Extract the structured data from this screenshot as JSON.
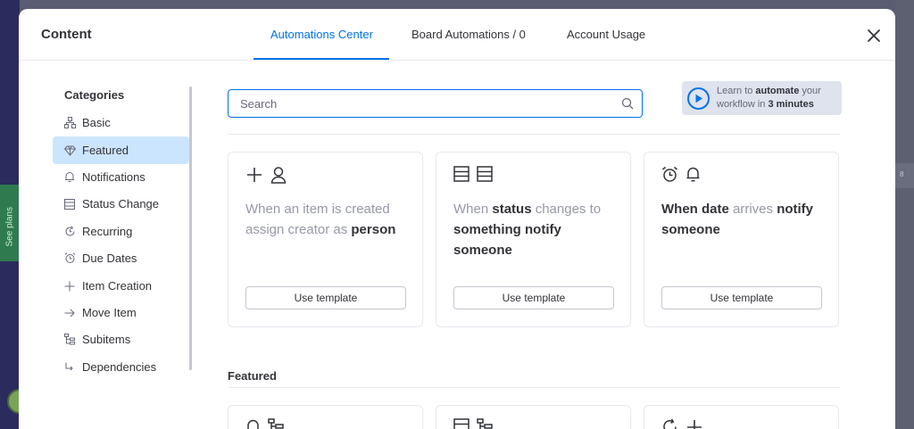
{
  "background": {
    "see_plans": "See plans",
    "right_count": "8"
  },
  "modal": {
    "title": "Content",
    "tabs": [
      {
        "label": "Automations Center",
        "active": true
      },
      {
        "label": "Board Automations / 0",
        "active": false
      },
      {
        "label": "Account Usage",
        "active": false
      }
    ],
    "close_icon": "close-icon"
  },
  "sidebar": {
    "heading": "Categories",
    "items": [
      {
        "label": "Basic",
        "icon": "sitemap-icon",
        "active": false
      },
      {
        "label": "Featured",
        "icon": "diamond-icon",
        "active": true
      },
      {
        "label": "Notifications",
        "icon": "bell-icon",
        "active": false
      },
      {
        "label": "Status Change",
        "icon": "table-icon",
        "active": false
      },
      {
        "label": "Recurring",
        "icon": "recurring-icon",
        "active": false
      },
      {
        "label": "Due Dates",
        "icon": "alarm-icon",
        "active": false
      },
      {
        "label": "Item Creation",
        "icon": "plus-icon",
        "active": false
      },
      {
        "label": "Move Item",
        "icon": "arrow-right-icon",
        "active": false
      },
      {
        "label": "Subitems",
        "icon": "subitems-icon",
        "active": false
      },
      {
        "label": "Dependencies",
        "icon": "dependency-icon",
        "active": false
      }
    ]
  },
  "search": {
    "placeholder": "Search",
    "value": ""
  },
  "learn": {
    "prefix": "Learn to ",
    "bold1": "automate",
    "middle": " your workflow in ",
    "bold2": "3 minutes"
  },
  "cards": [
    {
      "icons": [
        "plus-icon",
        "person-icon"
      ],
      "text_parts": [
        {
          "t": "When an item is created assign creator as ",
          "style": "light"
        },
        {
          "t": "person",
          "style": "bold"
        }
      ],
      "button": "Use template"
    },
    {
      "icons": [
        "table-icon",
        "table-icon"
      ],
      "text_parts": [
        {
          "t": "When ",
          "style": "light"
        },
        {
          "t": "status",
          "style": "bold"
        },
        {
          "t": " changes to ",
          "style": "light"
        },
        {
          "t": "something notify someone",
          "style": "bold"
        }
      ],
      "button": "Use template"
    },
    {
      "icons": [
        "alarm-icon",
        "bell-icon"
      ],
      "text_parts": [
        {
          "t": "When date",
          "style": "bold"
        },
        {
          "t": " arrives ",
          "style": "light"
        },
        {
          "t": "notify someone",
          "style": "bold"
        }
      ],
      "button": "Use template"
    }
  ],
  "featured": {
    "title": "Featured",
    "cards_icons": [
      [
        "bell-icon",
        "subitems-icon"
      ],
      [
        "table-icon",
        "subitems-icon"
      ],
      [
        "recurring-icon",
        "plus-icon"
      ]
    ]
  },
  "colors": {
    "accent": "#0073ea",
    "active_bg": "#cce5ff",
    "text": "#323338",
    "muted": "#9699a6"
  }
}
